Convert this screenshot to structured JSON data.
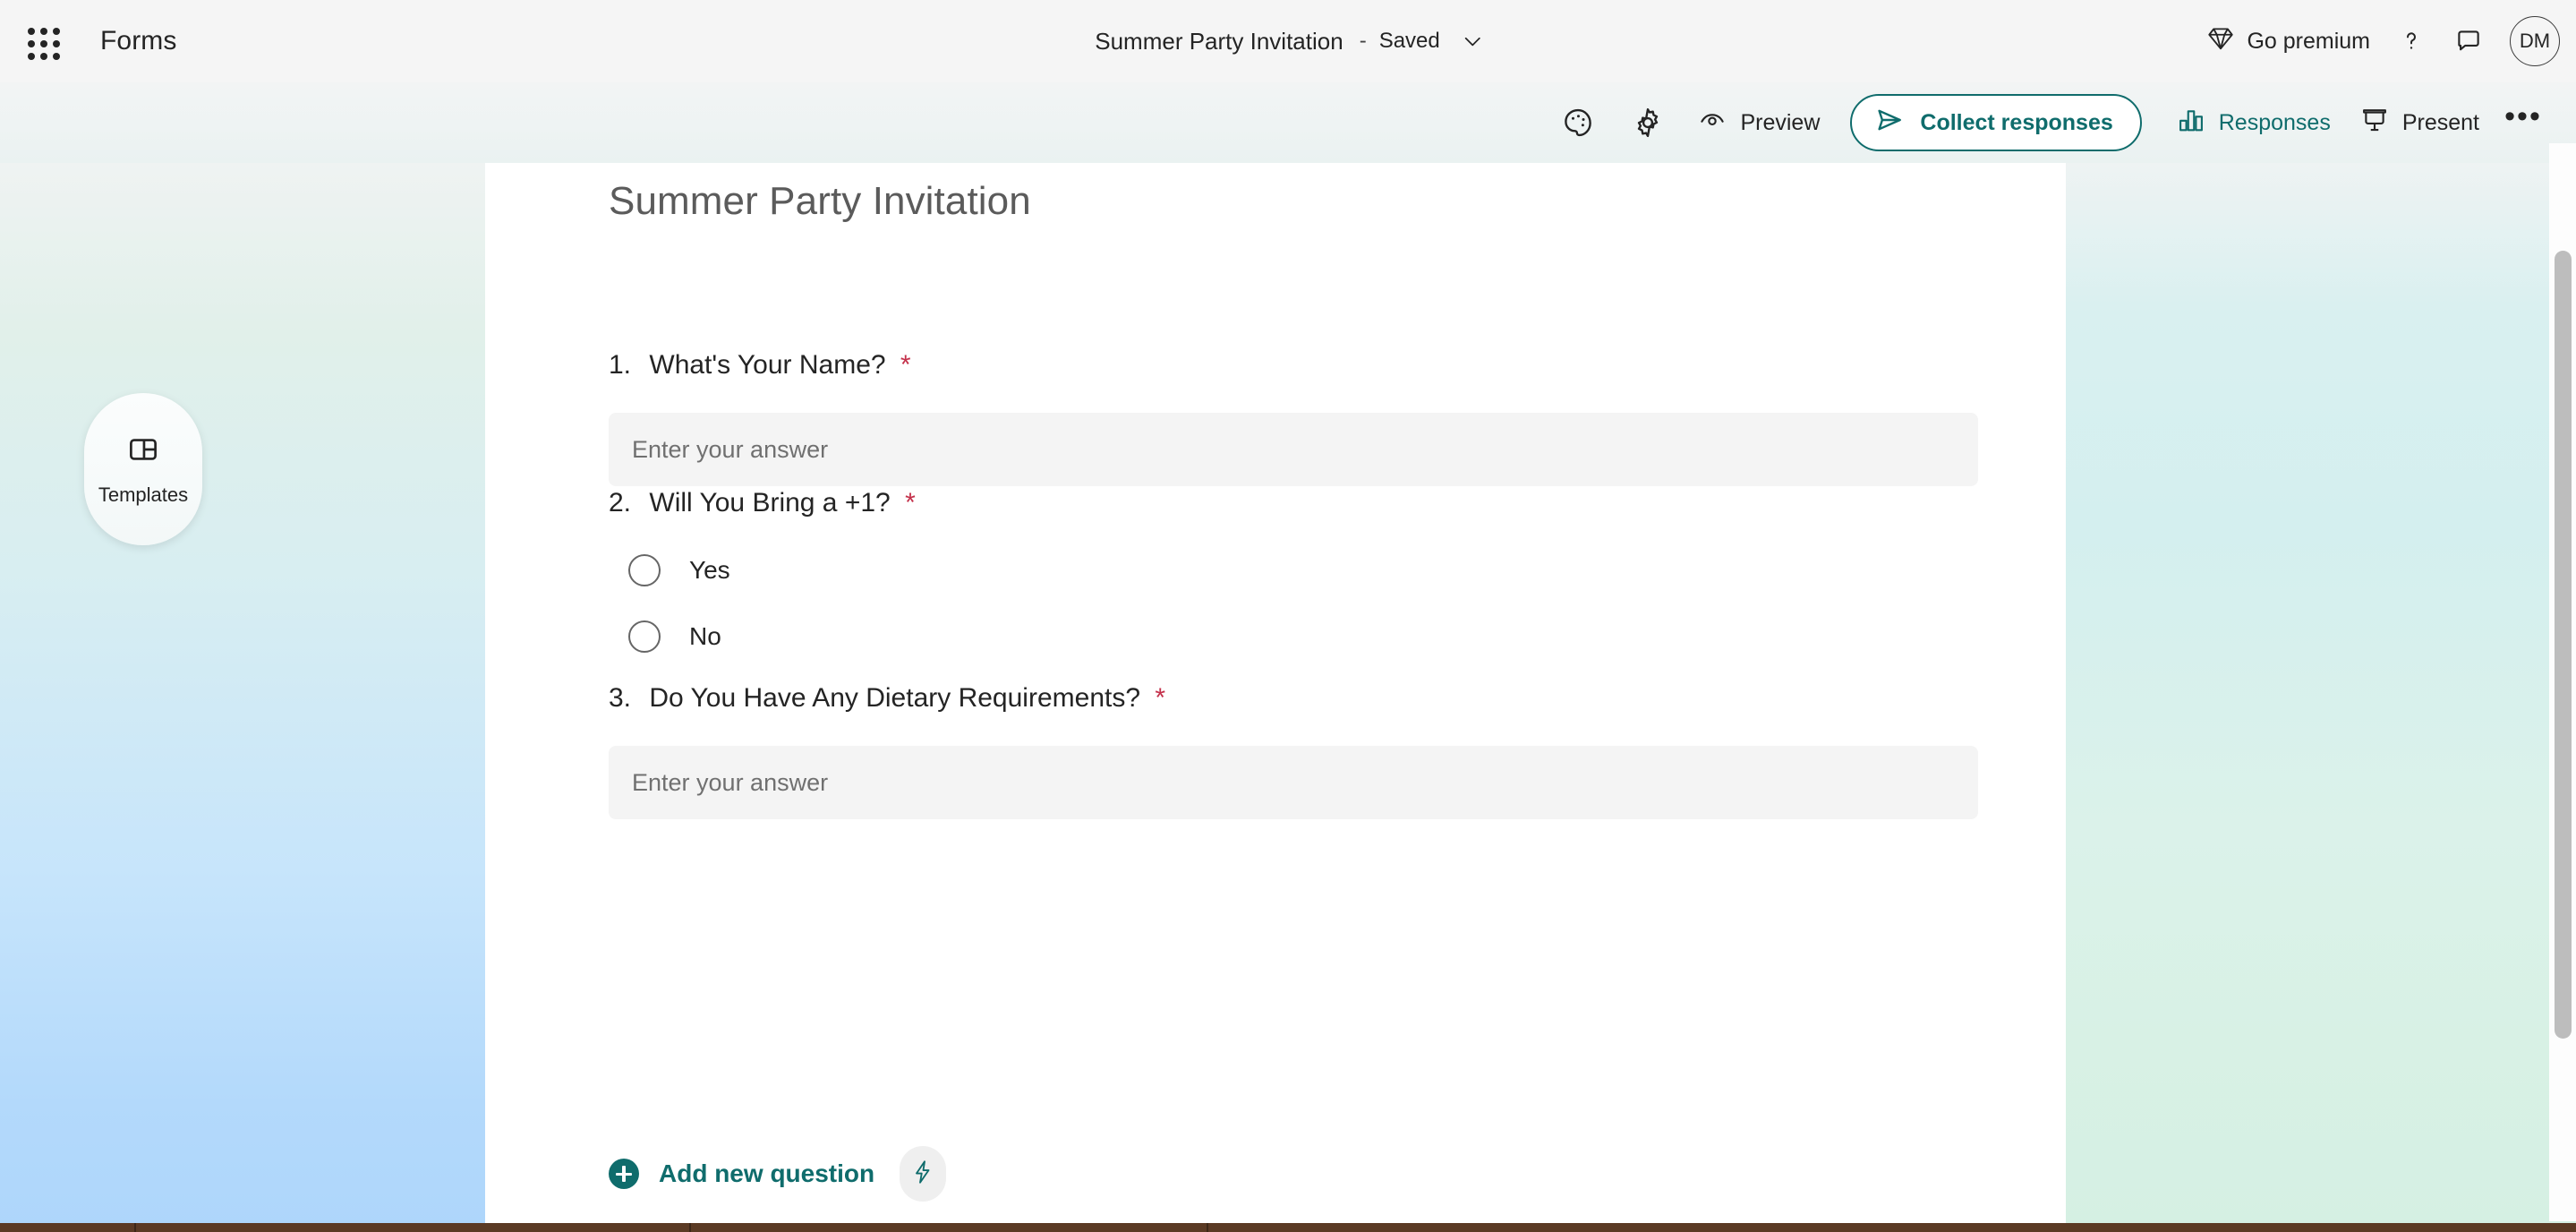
{
  "app": {
    "name": "Forms",
    "waffle_icon": "app-launcher-grid-icon"
  },
  "header": {
    "doc_title": "Summer Party Invitation",
    "separator": "-",
    "save_status": "Saved",
    "chevron_icon": "chevron-down-icon",
    "premium_label": "Go premium",
    "premium_icon": "diamond-icon",
    "help_icon": "question-mark-icon",
    "feedback_icon": "chat-bubble-icon",
    "avatar_initials": "DM"
  },
  "toolbar": {
    "theme_icon": "palette-icon",
    "settings_icon": "gear-icon",
    "preview_label": "Preview",
    "preview_icon": "eye-icon",
    "collect_label": "Collect responses",
    "collect_icon": "send-icon",
    "responses_label": "Responses",
    "responses_icon": "bar-chart-icon",
    "present_label": "Present",
    "present_icon": "presentation-screen-icon",
    "more_label": "•••"
  },
  "sidebar": {
    "templates_label": "Templates",
    "templates_icon": "layout-panels-icon"
  },
  "form": {
    "title": "Summer Party Invitation",
    "required_mark": "*",
    "questions": [
      {
        "number": "1.",
        "text": "What's Your Name?",
        "required": true,
        "type": "text",
        "placeholder": "Enter your answer"
      },
      {
        "number": "2.",
        "text": "Will You Bring a +1?",
        "required": true,
        "type": "choice",
        "options": [
          "Yes",
          "No"
        ]
      },
      {
        "number": "3.",
        "text": "Do You Have Any Dietary Requirements?",
        "required": true,
        "type": "text",
        "placeholder": "Enter your answer"
      }
    ],
    "add_question_label": "Add new question",
    "add_question_icon": "plus-circle-icon",
    "ai_suggest_icon": "lightning-bolt-icon"
  },
  "colors": {
    "accent_teal": "#0f6c6c",
    "required_red": "#c4314b",
    "header_bg": "#f5f5f5",
    "answer_field_bg": "#f4f4f4",
    "text_primary": "#242424",
    "title_gray": "#5b5b5b"
  }
}
